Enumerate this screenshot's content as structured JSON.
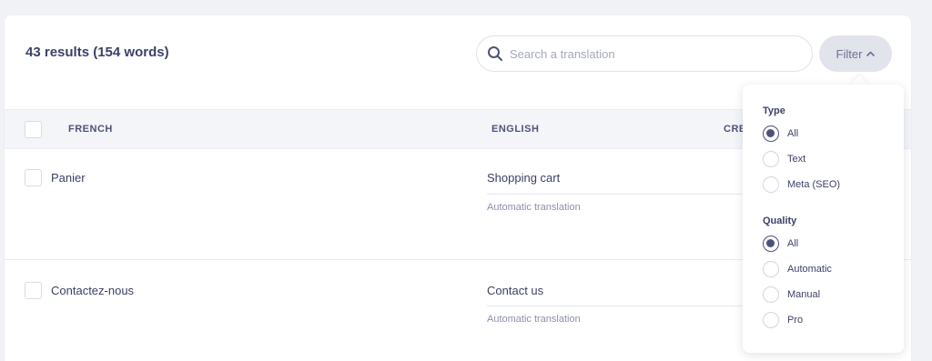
{
  "header": {
    "results_title": "43 results (154 words)",
    "search_placeholder": "Search a translation",
    "filter_label": "Filter"
  },
  "table": {
    "columns": [
      "FRENCH",
      "ENGLISH",
      "CRE"
    ],
    "rows": [
      {
        "source": "Panier",
        "target": "Shopping cart",
        "type": "Automatic translation"
      },
      {
        "source": "Contactez-nous",
        "target": "Contact us",
        "type": "Automatic translation"
      }
    ]
  },
  "filter_menu": {
    "type_title": "Type",
    "type_options": [
      "All",
      "Text",
      "Meta (SEO)"
    ],
    "type_selected": "All",
    "quality_title": "Quality",
    "quality_options": [
      "All",
      "Automatic",
      "Manual",
      "Pro"
    ],
    "quality_selected": "All"
  },
  "icons": {
    "search": "search-icon",
    "filter_caret": "chevron-up-icon"
  },
  "colors": {
    "accent": "#4e527a",
    "text": "#3c3f63",
    "muted": "#8c90aa"
  }
}
